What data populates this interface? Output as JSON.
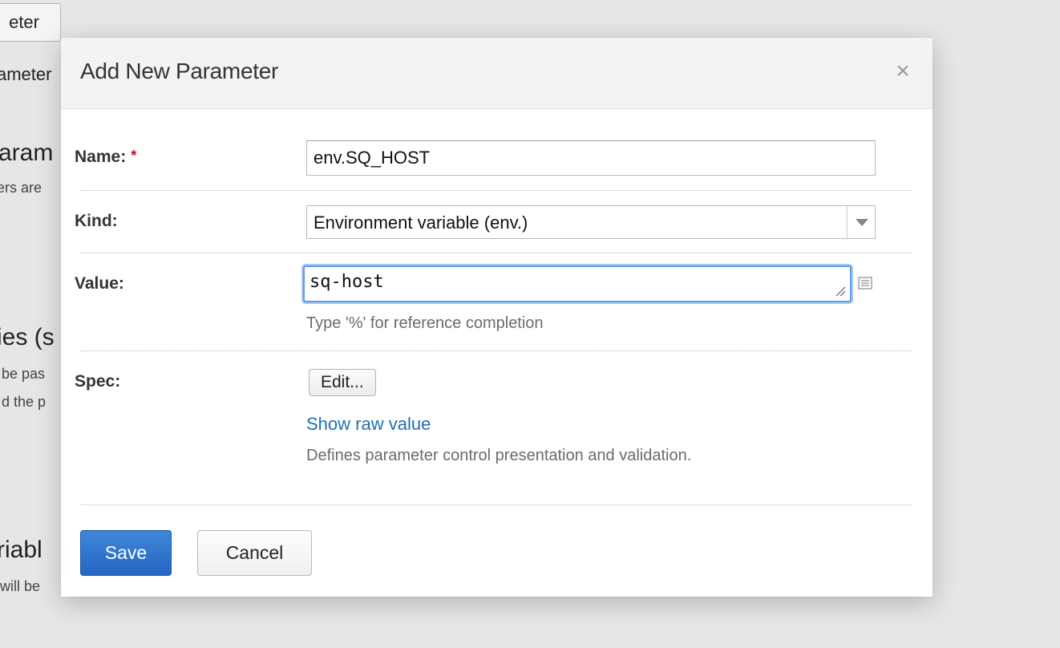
{
  "background": {
    "button_fragment": "eter",
    "lines": [
      "ameter",
      "aram",
      "ers are",
      "ies (s",
      "be pas",
      "d the p",
      "riabl",
      "will be"
    ]
  },
  "dialog": {
    "title": "Add New Parameter",
    "close_symbol": "×",
    "fields": {
      "name": {
        "label": "Name:",
        "required_mark": "*",
        "value": "env.SQ_HOST"
      },
      "kind": {
        "label": "Kind:",
        "selected": "Environment variable (env.)"
      },
      "value": {
        "label": "Value:",
        "value": "sq-host",
        "hint": "Type '%' for reference completion"
      },
      "spec": {
        "label": "Spec:",
        "edit_label": "Edit...",
        "raw_link": "Show raw value",
        "hint": "Defines parameter control presentation and validation."
      }
    },
    "buttons": {
      "save": "Save",
      "cancel": "Cancel"
    }
  },
  "colors": {
    "primary": "#2e72cc",
    "link": "#1f6fb5",
    "required": "#d0021b",
    "focus": "#5c9bea"
  },
  "icons": {
    "close": "close-icon",
    "dropdown": "chevron-down-icon",
    "expand": "expand-editor-icon",
    "resize": "resize-grip-icon"
  }
}
